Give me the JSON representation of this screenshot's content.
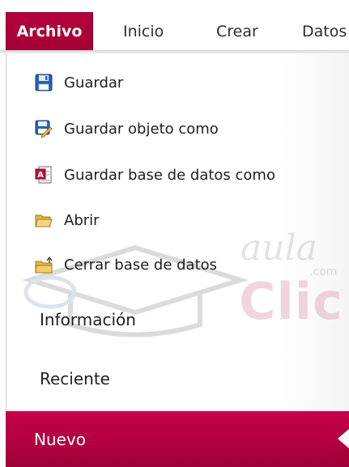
{
  "ribbon": {
    "file_tab": "Archivo",
    "tabs": [
      "Inicio",
      "Crear",
      "Datos"
    ]
  },
  "menu": {
    "commands": [
      {
        "label": "Guardar",
        "icon": "save-icon"
      },
      {
        "label": "Guardar objeto como",
        "icon": "save-object-as-icon"
      },
      {
        "label": "Guardar base de datos como",
        "icon": "save-database-as-icon"
      },
      {
        "label": "Abrir",
        "icon": "open-folder-icon"
      },
      {
        "label": "Cerrar base de datos",
        "icon": "close-database-icon"
      }
    ],
    "sections": [
      {
        "label": "Información"
      },
      {
        "label": "Reciente"
      },
      {
        "label": "Nuevo",
        "active": true
      }
    ]
  },
  "watermark": {
    "brand_top": "aula",
    "brand_domain": ".com",
    "brand_bottom": "Clic"
  },
  "colors": {
    "accent": "#a40033",
    "active_section": "#b10040"
  }
}
